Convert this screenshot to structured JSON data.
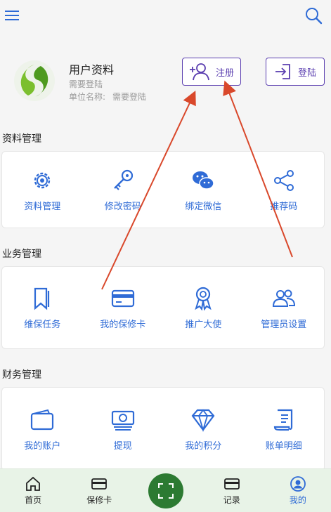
{
  "profile": {
    "name": "用户资料",
    "line1": "需要登陆",
    "unit_label": "单位名称:",
    "unit_value": "需要登陆"
  },
  "buttons": {
    "register": "注册",
    "login": "登陆"
  },
  "sections": [
    {
      "title": "资料管理",
      "items": [
        "资料管理",
        "修改密码",
        "绑定微信",
        "推荐码"
      ]
    },
    {
      "title": "业务管理",
      "items": [
        "维保任务",
        "我的保修卡",
        "推广大使",
        "管理员设置"
      ]
    },
    {
      "title": "财务管理",
      "items": [
        "我的账户",
        "提现",
        "我的积分",
        "账单明细"
      ]
    }
  ],
  "tabs": [
    "首页",
    "保修卡",
    "记录",
    "我的"
  ],
  "icons": {
    "menu": "menu-icon",
    "search": "search-icon",
    "register": "user-plus-icon",
    "login": "login-icon",
    "data_manage": "gear-icon",
    "password": "key-icon",
    "wechat": "wechat-icon",
    "share": "share-icon",
    "tasks": "bookmark-icon",
    "card": "card-icon",
    "ambassador": "medal-icon",
    "admins": "users-icon",
    "account": "wallet-icon",
    "withdraw": "cash-icon",
    "points": "diamond-icon",
    "bill": "receipt-icon",
    "home": "home-icon",
    "scan": "scan-icon",
    "me": "user-circle-icon"
  },
  "colors": {
    "accent": "#2f6bd6",
    "button": "#5b3fb0",
    "tabbar_bg": "#e8f3e7",
    "scan": "#2c7a32",
    "annotation": "#d9482b"
  }
}
